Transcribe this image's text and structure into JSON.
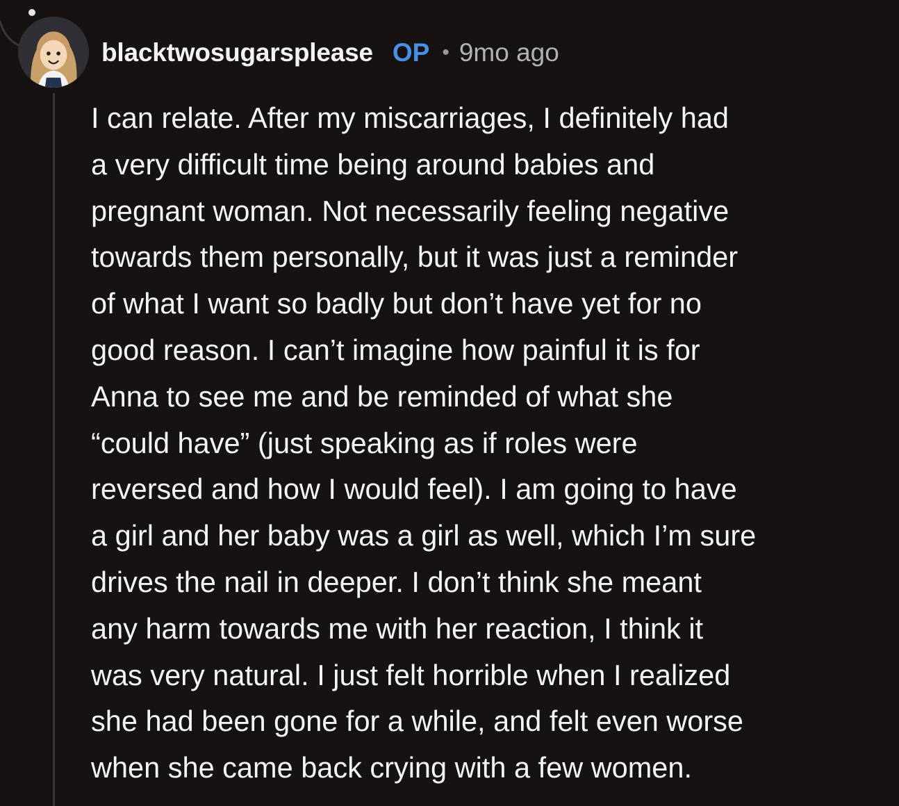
{
  "comment": {
    "username": "blacktwosugarsplease",
    "badge": "OP",
    "separator": "•",
    "timestamp": "9mo ago",
    "avatar_icon": "cartoon-avatar-icon",
    "body_lines": [
      "I can relate. After my miscarriages, I definitely had",
      "a very difficult time being around babies and",
      "pregnant woman. Not necessarily feeling negative",
      "towards them personally, but it was just a reminder",
      "of what I want so badly but don’t have yet for no",
      "good reason. I can’t imagine how painful it is for",
      "Anna to see me and be reminded of what she",
      "“could have” (just speaking as if roles were",
      "reversed and how I would feel). I am going to have",
      "a girl and her baby was a girl as well, which I’m sure",
      "drives the nail in deeper. I don’t think she meant",
      "any harm towards me with her reaction, I think it",
      "was very natural. I just felt horrible when I realized",
      "she had been gone for a while, and felt even worse",
      "when she came back crying with a few women."
    ]
  },
  "colors": {
    "background": "#161211",
    "text": "#f5f5f5",
    "op_badge": "#4a8fe6",
    "meta": "#b2b2b2",
    "thread_line": "#3b3634"
  }
}
